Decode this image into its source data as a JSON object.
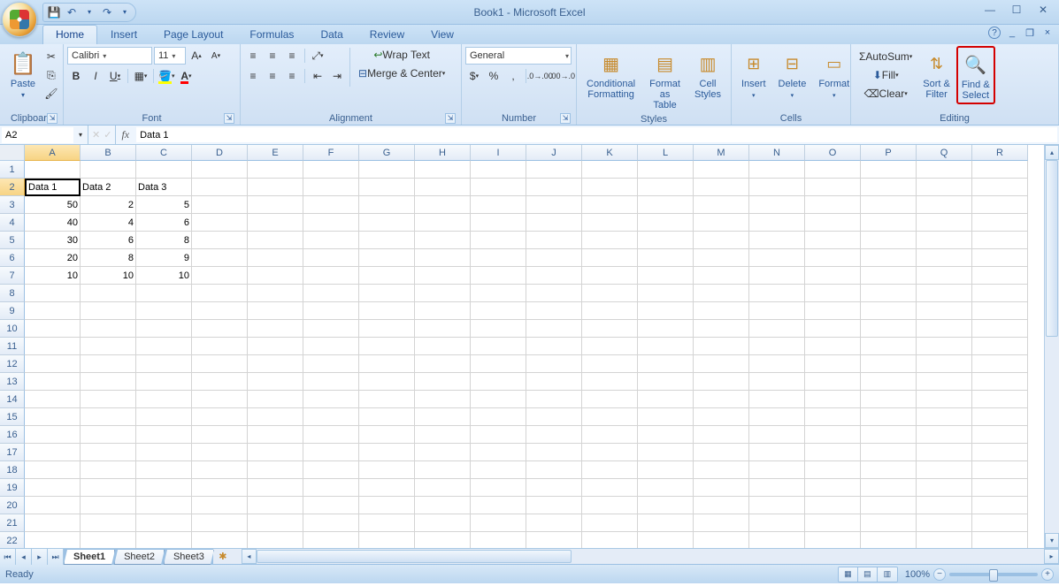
{
  "title": "Book1 - Microsoft Excel",
  "qat": {
    "save": "save-icon",
    "undo": "undo-icon",
    "redo": "redo-icon"
  },
  "tabs": [
    "Home",
    "Insert",
    "Page Layout",
    "Formulas",
    "Data",
    "Review",
    "View"
  ],
  "active_tab": 0,
  "ribbon": {
    "clipboard": {
      "label": "Clipboard",
      "paste": "Paste"
    },
    "font": {
      "label": "Font",
      "name": "Calibri",
      "size": "11",
      "bold": "B",
      "italic": "I",
      "underline": "U"
    },
    "alignment": {
      "label": "Alignment",
      "wrap": "Wrap Text",
      "merge": "Merge & Center"
    },
    "number": {
      "label": "Number",
      "format": "General"
    },
    "styles": {
      "label": "Styles",
      "cond": "Conditional\nFormatting",
      "table": "Format\nas Table",
      "cell": "Cell\nStyles"
    },
    "cells": {
      "label": "Cells",
      "insert": "Insert",
      "delete": "Delete",
      "format": "Format"
    },
    "editing": {
      "label": "Editing",
      "autosum": "AutoSum",
      "fill": "Fill",
      "clear": "Clear",
      "sort": "Sort &\nFilter",
      "find": "Find &\nSelect"
    }
  },
  "namebox": "A2",
  "formula": "Data 1",
  "columns": [
    "A",
    "B",
    "C",
    "D",
    "E",
    "F",
    "G",
    "H",
    "I",
    "J",
    "K",
    "L",
    "M",
    "N",
    "O",
    "P",
    "Q",
    "R"
  ],
  "rows": 22,
  "active_cell": {
    "row": 2,
    "col": 0
  },
  "data": {
    "2": {
      "0": "Data 1",
      "1": "Data 2",
      "2": "Data 3"
    },
    "3": {
      "0": "50",
      "1": "2",
      "2": "5"
    },
    "4": {
      "0": "40",
      "1": "4",
      "2": "6"
    },
    "5": {
      "0": "30",
      "1": "6",
      "2": "8"
    },
    "6": {
      "0": "20",
      "1": "8",
      "2": "9"
    },
    "7": {
      "0": "10",
      "1": "10",
      "2": "10"
    }
  },
  "sheets": [
    "Sheet1",
    "Sheet2",
    "Sheet3"
  ],
  "active_sheet": 0,
  "status": "Ready",
  "zoom": "100%"
}
